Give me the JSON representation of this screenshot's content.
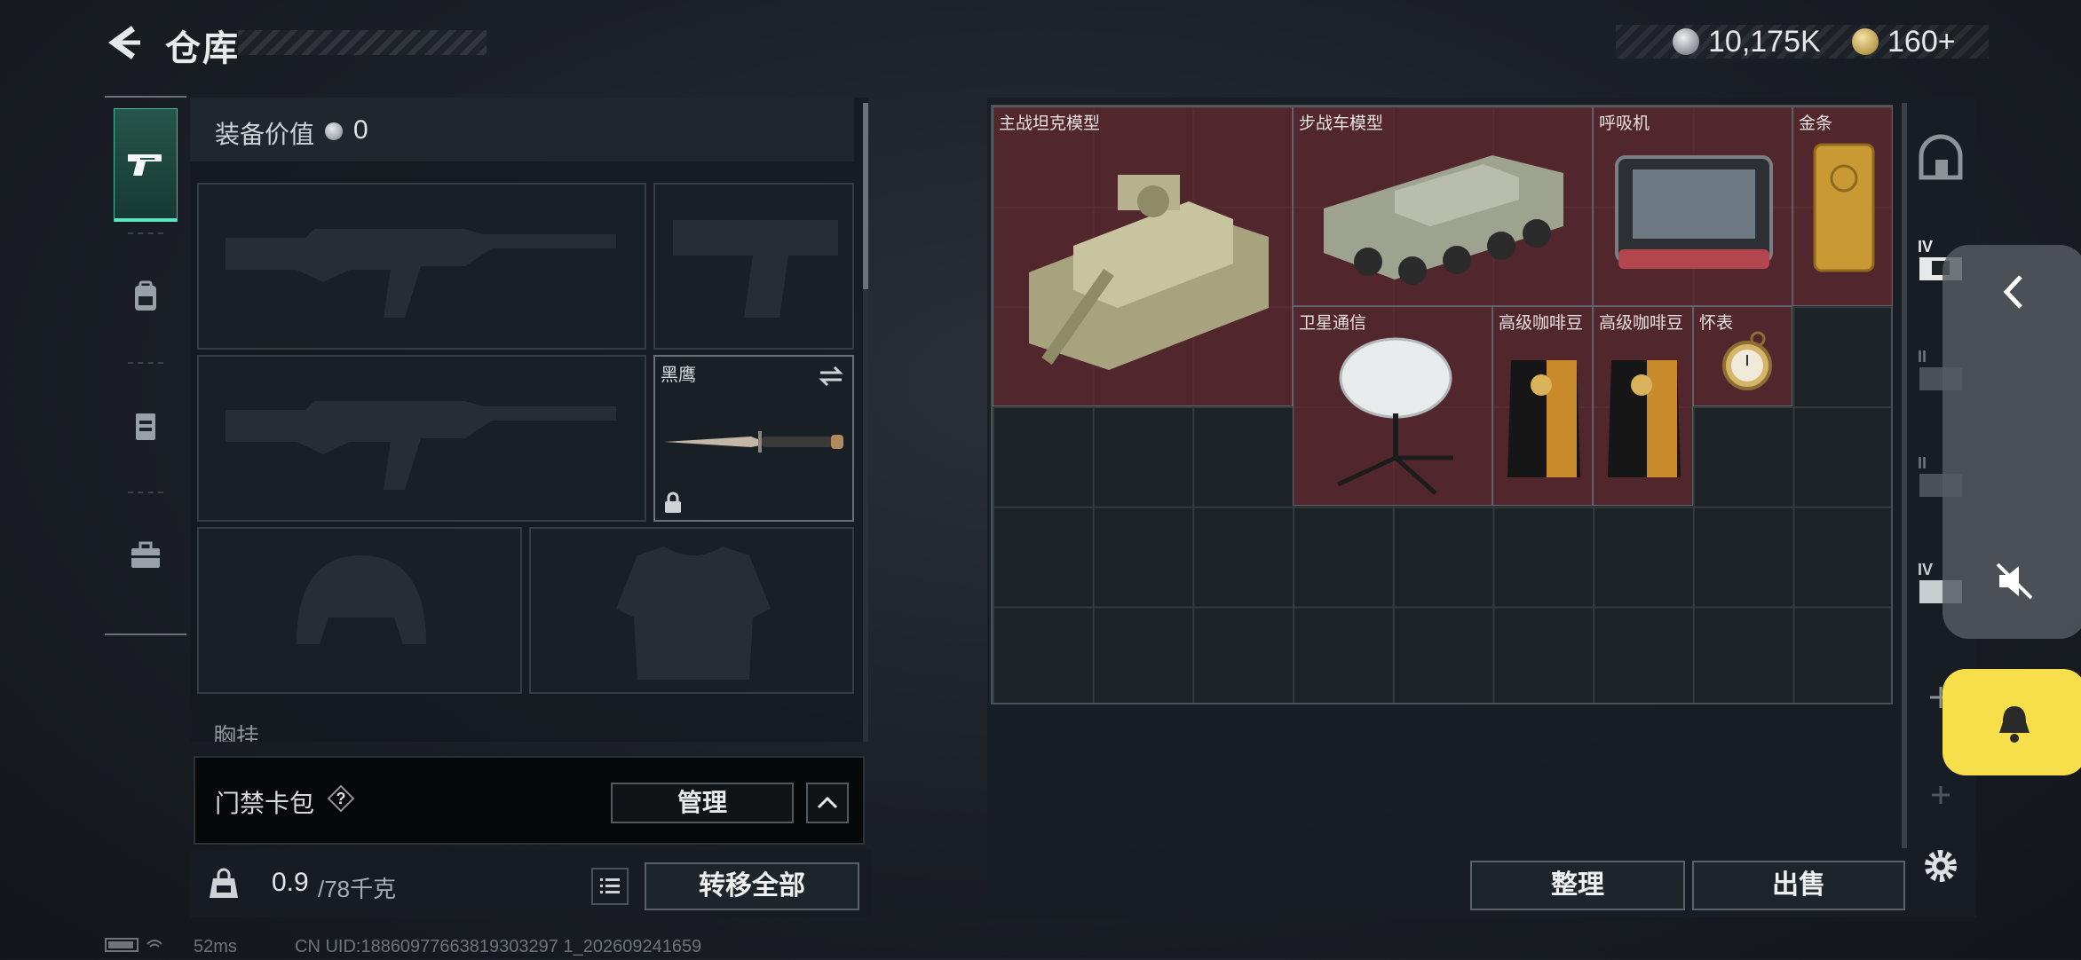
{
  "header": {
    "title": "仓库",
    "currency_silver": "10,175K",
    "currency_gold": "160+"
  },
  "equipment": {
    "value_label": "装备价值",
    "value": "0",
    "knife_name": "黑鹰",
    "chest_label": "胸挂"
  },
  "keycard": {
    "label": "门禁卡包",
    "help": "?",
    "manage_label": "管理"
  },
  "weight": {
    "current": "0.9",
    "max": "/78千克"
  },
  "actions": {
    "transfer_all": "转移全部",
    "sort": "整理",
    "sell": "出售"
  },
  "storage_items": [
    {
      "name": "主战坦克模型",
      "icon": "tank-model"
    },
    {
      "name": "步战车模型",
      "icon": "ifv-model"
    },
    {
      "name": "呼吸机",
      "icon": "ventilator"
    },
    {
      "name": "金条",
      "icon": "gold-bar"
    },
    {
      "name": "卫星通信",
      "icon": "satellite-dish"
    },
    {
      "name": "高级咖啡豆",
      "icon": "coffee-bag"
    },
    {
      "name": "高级咖啡豆",
      "icon": "coffee-bag"
    },
    {
      "name": "怀表",
      "icon": "pocket-watch"
    }
  ],
  "side_tabs": [
    "II",
    "II",
    "IV",
    "IV"
  ],
  "status": {
    "ping": "52ms",
    "uid": "CN UID:18860977663819303297 1_202609241659"
  },
  "colors": {
    "accent": "#5fe3bf",
    "notify": "#f6df4b",
    "item_bg": "#622830"
  }
}
